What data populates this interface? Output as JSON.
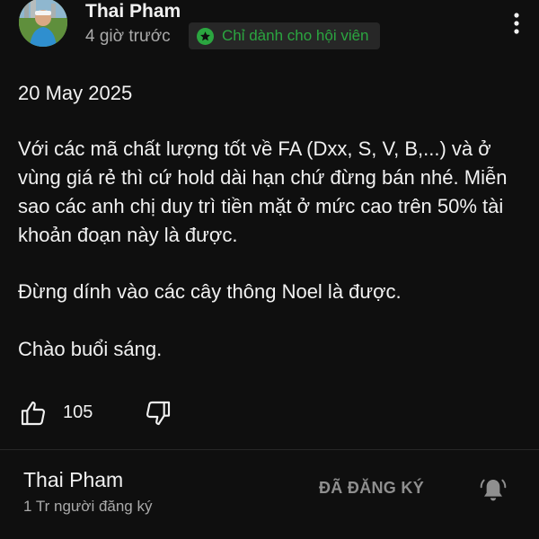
{
  "post": {
    "author": "Thai Pham",
    "time": "4 giờ trước",
    "members_badge": "Chỉ dành cho hội viên",
    "paragraphs": [
      "20 May 2025",
      "Với các mã chất lượng tốt về FA (Dxx, S, V, B,...) và ở vùng giá rẻ thì cứ hold dài hạn chứ đừng bán nhé. Miễn sao các anh chị duy trì tiền mặt ở mức cao trên 50% tài khoản đoạn này là được.",
      "Đừng dính vào các cây thông Noel là được.",
      "Chào buổi sáng."
    ],
    "likes": "105"
  },
  "icons": {
    "more": "more-vertical-icon",
    "badge": "star-icon",
    "like": "thumbs-up-icon",
    "dislike": "thumbs-down-icon",
    "bell": "bell-icon"
  },
  "channel": {
    "name": "Thai Pham",
    "subscribers": "1 Tr người đăng ký",
    "subscribed_label": "ĐÃ ĐĂNG KÝ"
  },
  "colors": {
    "background": "#0f0f0f",
    "badge_green": "#2ba640",
    "secondary_text": "#aaaaaa"
  }
}
